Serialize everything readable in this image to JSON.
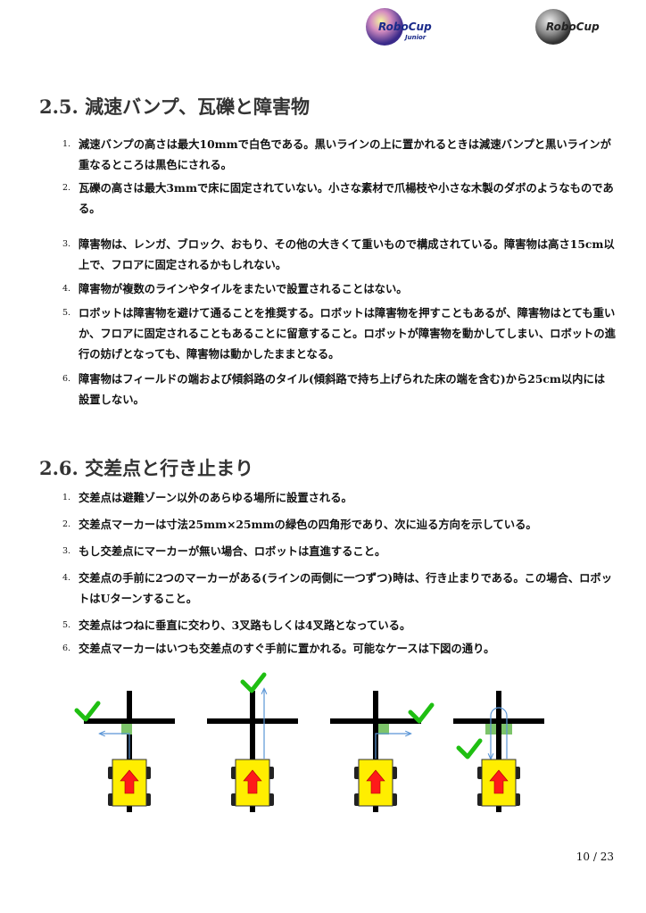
{
  "logos": [
    {
      "main": "RoboCup",
      "sub": "Junior"
    },
    {
      "main": "RoboCup"
    }
  ],
  "section1": {
    "number": "2.5.",
    "title": "減速バンプ、瓦礫と障害物",
    "items": [
      {
        "n": "1.",
        "text": "減速バンプの高さは最大10mmで白色である。黒いラインの上に置かれるときは減速バンプと黒いラインが重なるところは黒色にされる。"
      },
      {
        "n": "2.",
        "text": "瓦礫の高さは最大3mmで床に固定されていない。小さな素材で爪楊枝や小さな木製のダボのようなものである。"
      },
      {
        "n": "3.",
        "text": "障害物は、レンガ、ブロック、おもり、その他の大きくて重いもので構成されている。障害物は高さ15cm以上で、フロアに固定されるかもしれない。"
      },
      {
        "n": "4.",
        "text": "障害物が複数のラインやタイルをまたいで設置されることはない。"
      },
      {
        "n": "5.",
        "text": "ロボットは障害物を避けて通ることを推奨する。ロボットは障害物を押すこともあるが、障害物はとても重いか、フロアに固定されることもあることに留意すること。ロボットが障害物を動かしてしまい、ロボットの進行の妨げとなっても、障害物は動かしたままとなる。"
      },
      {
        "n": "6.",
        "text": "障害物はフィールドの端および傾斜路のタイル(傾斜路で持ち上げられた床の端を含む)から25cm以内には設置しない。"
      }
    ]
  },
  "section2": {
    "number": "2.6.",
    "title": "交差点と行き止まり",
    "items": [
      {
        "n": "1.",
        "text": "交差点は避難ゾーン以外のあらゆる場所に設置される。"
      },
      {
        "n": "2.",
        "text": "交差点マーカーは寸法25mm×25mmの緑色の四角形であり、次に辿る方向を示している。"
      },
      {
        "n": "3.",
        "text": "もし交差点にマーカーが無い場合、ロボットは直進すること。"
      },
      {
        "n": "4.",
        "text": "交差点の手前に2つのマーカーがある(ラインの両側に一つずつ)時は、行き止まりである。この場合、ロボットはUターンすること。"
      },
      {
        "n": "5.",
        "text": "交差点はつねに垂直に交わり、3叉路もしくは4叉路となっている。"
      },
      {
        "n": "6.",
        "text": "交差点マーカーはいつも交差点のすぐ手前に置かれる。可能なケースは下図の通り。"
      }
    ]
  },
  "figure": {
    "cases": [
      "left-turn",
      "straight",
      "right-turn",
      "u-turn"
    ],
    "colors": {
      "line": "#000000",
      "marker": "#7dc46a",
      "check": "#1fbf12",
      "robot": "#ffee00",
      "arrow": "#ff1a1a",
      "path": "#5a95d6"
    }
  },
  "footer": {
    "page": "10 / 23"
  }
}
